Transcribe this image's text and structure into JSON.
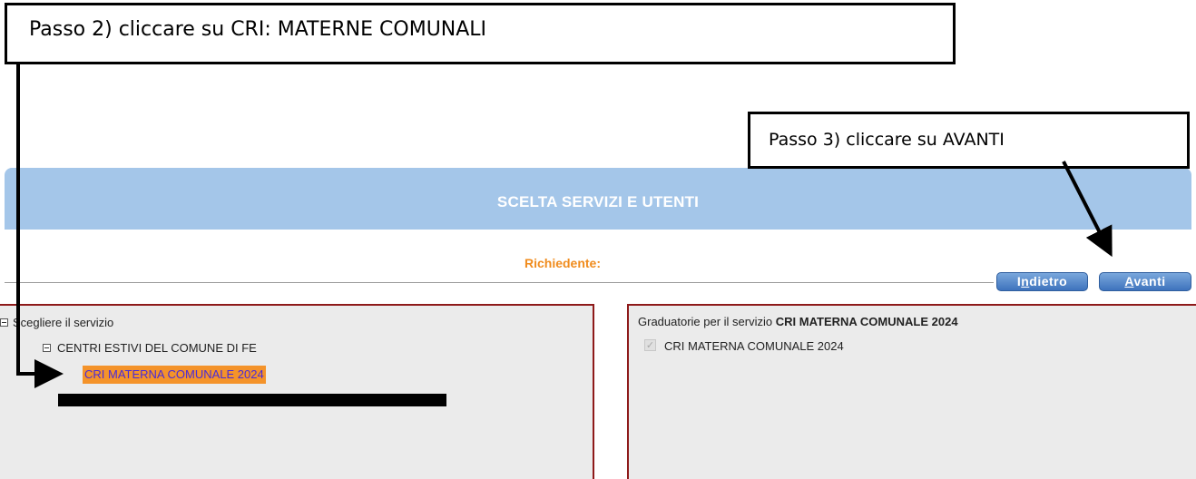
{
  "annotations": {
    "step2": "Passo 2) cliccare su CRI: MATERNE COMUNALI",
    "step3": "Passo 3) cliccare su AVANTI"
  },
  "header": {
    "title": "SCELTA SERVIZI E UTENTI",
    "color": "#a4c6e9"
  },
  "requester": {
    "label": "Richiedente:",
    "value": ""
  },
  "buttons": {
    "back_prefix": "I",
    "back_accel": "n",
    "back_rest": "dietro",
    "next_accel": "A",
    "next_rest": "vanti"
  },
  "service_tree": {
    "root": "Scegliere il servizio",
    "group": "CENTRI ESTIVI DEL COMUNE DI FE",
    "selected_item": "CRI MATERNA COMUNALE 2024"
  },
  "rankings": {
    "heading_prefix": "Graduatorie per il servizio",
    "heading_service": "CRI MATERNA COMUNALE 2024",
    "items": [
      {
        "label": "CRI MATERNA COMUNALE 2024",
        "checked": true,
        "disabled": true
      }
    ]
  },
  "colors": {
    "accent_orange": "#f08c1e",
    "selected_bg": "#f4932a",
    "selected_text": "#4a2bd8",
    "panel_border": "#8e1a1a",
    "button_blue": "#3e73bd"
  }
}
